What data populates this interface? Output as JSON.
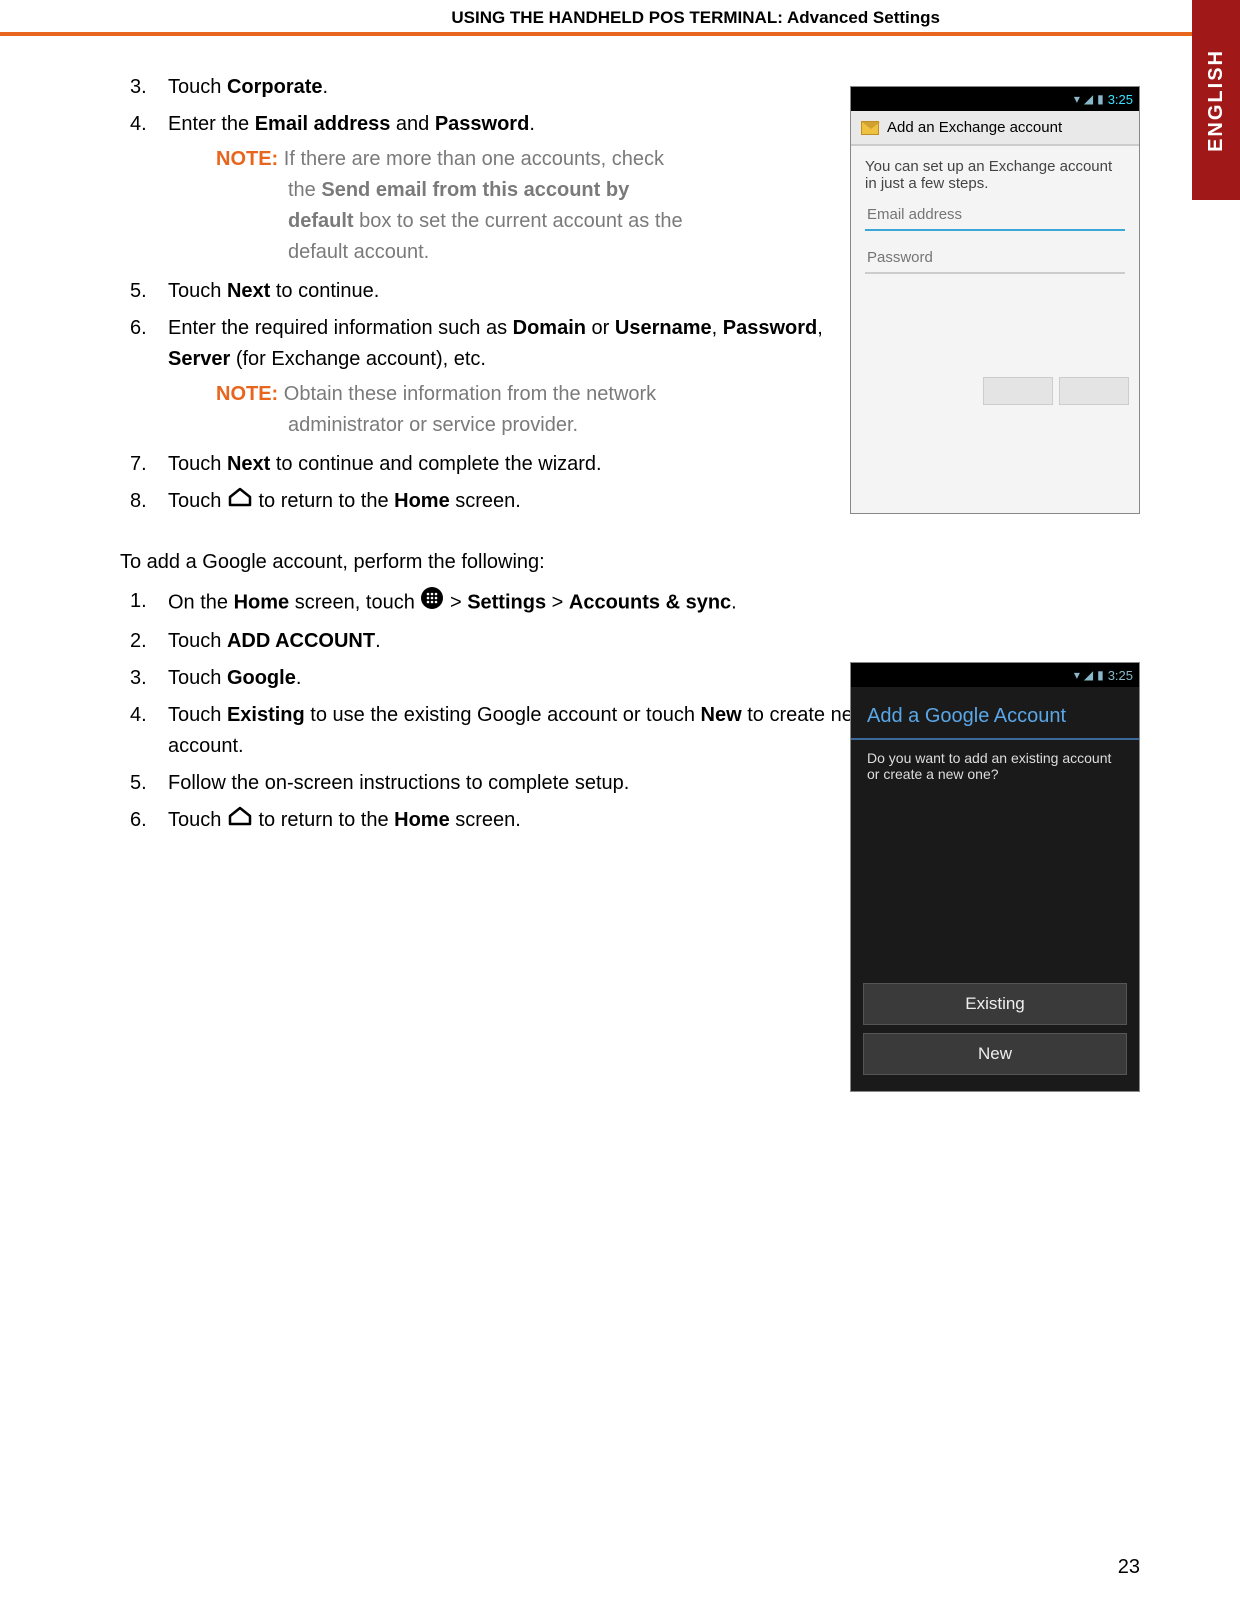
{
  "header": {
    "title": "USING THE HANDHELD POS TERMINAL: Advanced Settings"
  },
  "language_tab": "ENGLISH",
  "page_number": "23",
  "list1": {
    "item3": {
      "num": "3.",
      "pre": "Touch ",
      "bold": "Corporate",
      "post": "."
    },
    "item4": {
      "num": "4.",
      "pre": "Enter the ",
      "b1": "Email address",
      "mid": " and ",
      "b2": "Password",
      "post": "."
    },
    "note1": {
      "label": "NOTE:",
      "line1": " If there are more than one accounts, check",
      "line2_pre": "the ",
      "line2_bold": "Send email from this account by",
      "line3_bold": "default",
      "line3_post": " box to set the current account as the",
      "line4": "default account."
    },
    "item5": {
      "num": "5.",
      "pre": "Touch ",
      "bold": "Next",
      "post": " to continue."
    },
    "item6": {
      "num": "6.",
      "pre": "Enter the required information such as ",
      "b1": "Domain",
      "mid1": " or ",
      "b2": "Username",
      "mid2": ", ",
      "b3": "Password",
      "mid3": ", ",
      "b4": "Server",
      "post": " (for Exchange account), etc."
    },
    "note2": {
      "label": "NOTE:",
      "line1": " Obtain these information from the network",
      "line2": "administrator or service provider."
    },
    "item7": {
      "num": "7.",
      "pre": "Touch ",
      "bold": "Next",
      "post": " to continue and complete the wizard."
    },
    "item8": {
      "num": "8.",
      "pre": "Touch ",
      "mid": " to return to the ",
      "bold": "Home",
      "post": " screen."
    }
  },
  "google_intro": "To add a Google account, perform the following:",
  "list2": {
    "item1": {
      "num": "1.",
      "pre": "On the ",
      "b1": "Home",
      "mid1": " screen, touch ",
      "gt": " > ",
      "b2": "Settings",
      "gt2": " > ",
      "b3": "Accounts & sync",
      "post": "."
    },
    "item2": {
      "num": "2.",
      "pre": "Touch ",
      "bold": "ADD ACCOUNT",
      "post": "."
    },
    "item3": {
      "num": "3.",
      "pre": "Touch ",
      "bold": "Google",
      "post": "."
    },
    "item4": {
      "num": "4.",
      "pre": "Touch ",
      "b1": "Existing",
      "mid": " to use the existing Google account or touch ",
      "b2": "New",
      "post": " to create new account."
    },
    "item5": {
      "num": "5.",
      "text": "Follow the on-screen instructions to complete setup."
    },
    "item6": {
      "num": "6.",
      "pre": "Touch ",
      "mid": " to return to the ",
      "bold": "Home",
      "post": " screen."
    }
  },
  "screenshot1": {
    "time": "3:25",
    "title": "Add an Exchange account",
    "body": "You can set up an Exchange account in just a few steps.",
    "email_placeholder": "Email address",
    "password_placeholder": "Password"
  },
  "screenshot2": {
    "time": "3:25",
    "title": "Add a Google Account",
    "question": "Do you want to add an existing account or create a new one?",
    "btn_existing": "Existing",
    "btn_new": "New"
  }
}
